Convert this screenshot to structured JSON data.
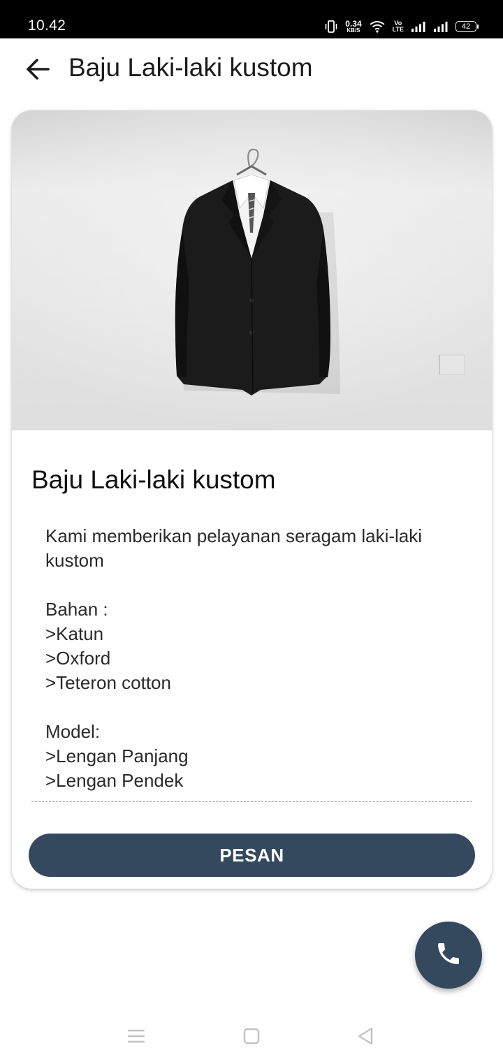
{
  "status_bar": {
    "time": "10.42",
    "net_speed": "0.34",
    "net_speed_unit": "KB/S",
    "volte_top": "Vo",
    "volte_bottom": "LTE",
    "battery": "42",
    "icons": [
      "vibrate-icon",
      "wifi-icon",
      "signal-icon",
      "signal-icon"
    ]
  },
  "app_bar": {
    "back_icon": "arrow-back-icon",
    "title": "Baju Laki-laki kustom"
  },
  "product": {
    "image": "black-suit-jacket-on-hanger",
    "title": "Baju Laki-laki kustom",
    "description_lines": [
      "Kami  memberikan pelayanan seragam laki-laki kustom",
      "",
      "Bahan :",
      ">Katun",
      ">Oxford",
      ">Teteron cotton",
      "",
      "Model:",
      ">Lengan Panjang",
      ">Lengan Pendek"
    ],
    "order_button_label": "PESAN",
    "accent_color": "#34495e"
  },
  "fab": {
    "icon": "phone-icon"
  },
  "nav_bar": {
    "icons": [
      "menu-icon",
      "home-square-icon",
      "back-triangle-icon"
    ]
  }
}
